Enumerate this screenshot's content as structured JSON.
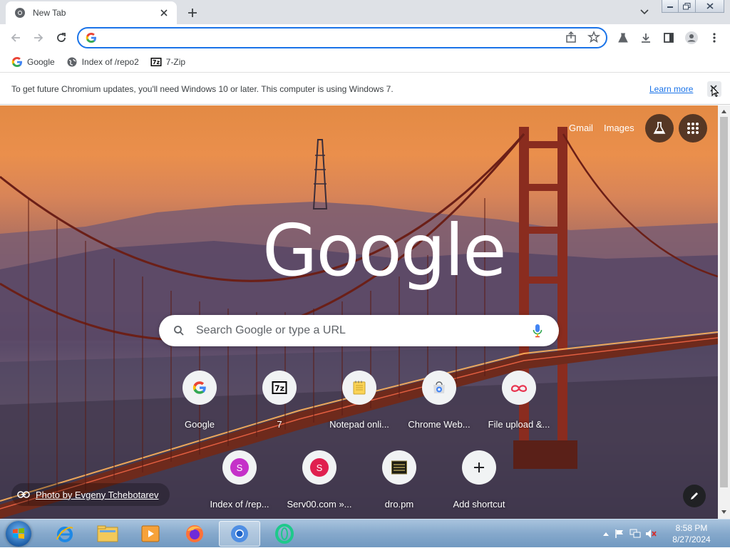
{
  "tab": {
    "title": "New Tab"
  },
  "omnibox": {
    "value": "",
    "placeholder": ""
  },
  "bookmarks": [
    {
      "label": "Google",
      "icon": "google-g-icon"
    },
    {
      "label": "Index of /repo2",
      "icon": "globe-icon"
    },
    {
      "label": "7-Zip",
      "icon": "7zip-icon"
    }
  ],
  "infobar": {
    "message": "To get future Chromium updates, you'll need Windows 10 or later. This computer is using Windows 7.",
    "link": "Learn more"
  },
  "ntp": {
    "links": {
      "gmail": "Gmail",
      "images": "Images"
    },
    "logo": "Google",
    "search_placeholder": "Search Google or type a URL",
    "shortcuts": [
      {
        "label": "Google",
        "icon": "google-g-icon"
      },
      {
        "label": "7",
        "icon": "7zip-icon"
      },
      {
        "label": "Notepad onli...",
        "icon": "notepad-icon"
      },
      {
        "label": "Chrome Web...",
        "icon": "chrome-webstore-icon"
      },
      {
        "label": "File upload &...",
        "icon": "file-upload-icon"
      },
      {
        "label": "Index of /rep...",
        "icon": "letter-s-icon",
        "letter": "S"
      },
      {
        "label": "Serv00.com »...",
        "icon": "letter-s-icon",
        "letter": "S"
      },
      {
        "label": "dro.pm",
        "icon": "dro-pm-icon"
      },
      {
        "label": "Add shortcut",
        "icon": "plus-icon"
      }
    ],
    "attribution": "Photo by Evgeny Tchebotarev"
  },
  "clock": {
    "time": "8:58 PM",
    "date": "8/27/2024"
  },
  "colors": {
    "accent": "#1a73e8",
    "tab_strip": "#dee1e6"
  }
}
